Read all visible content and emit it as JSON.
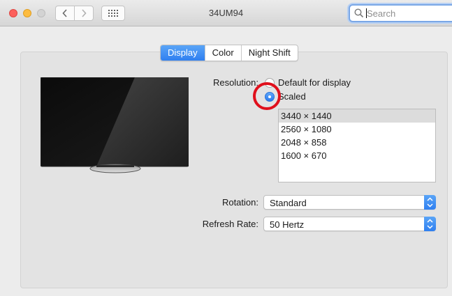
{
  "window": {
    "title": "34UM94"
  },
  "search": {
    "placeholder": "Search"
  },
  "tabs": [
    {
      "label": "Display",
      "active": true
    },
    {
      "label": "Color",
      "active": false
    },
    {
      "label": "Night Shift",
      "active": false
    }
  ],
  "resolution": {
    "label": "Resolution:",
    "options": [
      {
        "label": "Default for display",
        "selected": false
      },
      {
        "label": "Scaled",
        "selected": true
      }
    ],
    "scaled_list": [
      "3440 × 1440",
      "2560 × 1080",
      "2048 × 858",
      "1600 × 670"
    ],
    "selected_scaled": "3440 × 1440"
  },
  "rotation": {
    "label": "Rotation:",
    "value": "Standard"
  },
  "refresh_rate": {
    "label": "Refresh Rate:",
    "value": "50 Hertz"
  },
  "colors": {
    "accent": "#2f7ff0",
    "annotation_ring": "#e0101c"
  }
}
